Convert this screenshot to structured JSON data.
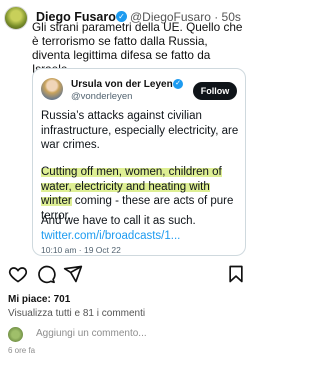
{
  "tweet": {
    "author_name": "Diego Fusaro",
    "handle_time": "@DiegoFusaro · 50s",
    "text": "Gli strani parametri della UE. Quello che è terrorismo se fatto dalla Russia, diventa legittima difesa se fatto da Israele."
  },
  "quoted": {
    "author_name": "Ursula von der Leyen",
    "handle": "@vonderleyen",
    "follow_label": "Follow",
    "para1": "Russia’s attacks against civilian infrastructure, especially electricity, are war crimes.",
    "para2_highlight": "Cutting off men, women, children of water, electricity and heating with winter",
    "para2_rest": " coming - these are acts of pure terror.",
    "para3_text": "And we have to call it as such. ",
    "para3_link": "twitter.com/i/broadcasts/1...",
    "timestamp": "10:10 am · 19 Oct 22"
  },
  "post": {
    "likes": "Mi piace: 701",
    "comments": "Visualizza tutti e 81 i commenti",
    "add_comment_placeholder": "Aggiungi un commento...",
    "time_ago": "6 ore fa"
  },
  "icons": {
    "like": "heart-icon",
    "comment": "comment-icon",
    "share": "send-icon",
    "save": "bookmark-icon"
  },
  "colors": {
    "link": "#1d9bf0",
    "highlight": "#cce65a",
    "follow_bg": "#0f1419"
  }
}
